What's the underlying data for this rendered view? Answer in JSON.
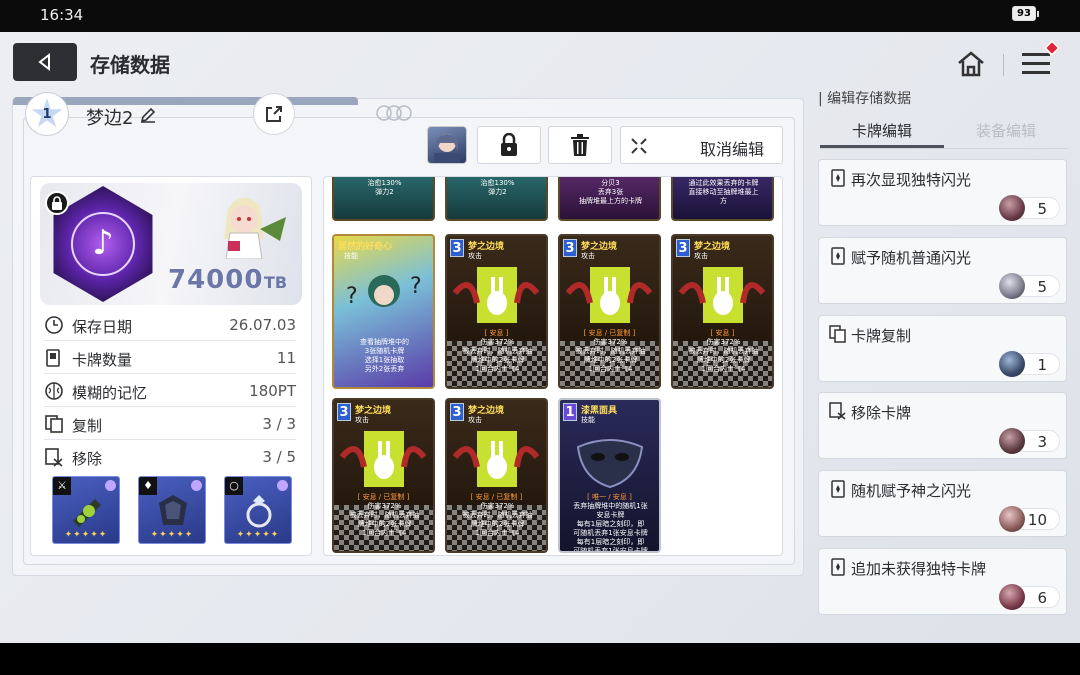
{
  "status": {
    "time": "16:34",
    "battery": "93"
  },
  "header": {
    "title": "存储数据"
  },
  "save": {
    "rank": "1",
    "name": "梦边2",
    "tb_value": "74000",
    "tb_unit": "TB",
    "stats": [
      {
        "label": "保存日期",
        "value": "26.07.03",
        "icon": "clock-icon"
      },
      {
        "label": "卡牌数量",
        "value": "11",
        "icon": "card-count-icon"
      },
      {
        "label": "模糊的记忆",
        "value": "180PT",
        "icon": "brain-icon"
      },
      {
        "label": "复制",
        "value": "3 / 3",
        "icon": "copy-icon"
      },
      {
        "label": "移除",
        "value": "3 / 5",
        "icon": "remove-icon"
      }
    ],
    "equipment": [
      {
        "slot": "weapon-icon",
        "stars": "✦✦✦✦✦"
      },
      {
        "slot": "armor-icon",
        "stars": "✦✦✦✦✦"
      },
      {
        "slot": "ring-icon",
        "stars": "✦✦✦✦✦"
      }
    ]
  },
  "toolbar": {
    "cancel_label": "取消编辑"
  },
  "deck": {
    "top_row": [
      {
        "desc": "治愈130%\n弹力2"
      },
      {
        "desc": "治愈130%\n弹力2"
      },
      {
        "desc": "分贝3\n丢弃3张\n抽牌堆最上方的卡牌"
      },
      {
        "desc": "通过此效果丢弃的卡牌\n直接移动至抽牌堆最上\n方"
      }
    ],
    "cards": [
      {
        "cost": "",
        "name": "居然的好奇心",
        "type": "技能",
        "tag": "",
        "desc": "查看抽牌堆中的\n3张随机卡牌\n选择1张抽取\n另外2张丢弃"
      },
      {
        "cost": "3",
        "name": "梦之边境",
        "type": "攻击",
        "tag": "[ 安息 ]",
        "desc": "伤害372%\n被丢弃时，随机丢弃抽\n牌堆中的2张卡牌\n1回合内士气4"
      },
      {
        "cost": "3",
        "name": "梦之边境",
        "type": "攻击",
        "tag": "[ 安息 / 已复制 ]",
        "desc": "伤害372%\n被丢弃时，随机丢弃抽\n牌堆中的2张卡牌\n1回合内士气4"
      },
      {
        "cost": "3",
        "name": "梦之边境",
        "type": "攻击",
        "tag": "[ 安息 ]",
        "desc": "伤害372%\n被丢弃时，随机丢弃抽\n牌堆中的2张卡牌\n1回合内士气4"
      },
      {
        "cost": "3",
        "name": "梦之边境",
        "type": "攻击",
        "tag": "[ 安息 / 已复制 ]",
        "desc": "伤害372%\n被丢弃时，随机丢弃抽\n牌堆中的2张卡牌\n1回合内士气4"
      },
      {
        "cost": "3",
        "name": "梦之边境",
        "type": "攻击",
        "tag": "[ 安息 / 已复制 ]",
        "desc": "伤害372%\n被丢弃时，随机丢弃抽\n牌堆中的2张卡牌\n1回合内士气4"
      },
      {
        "cost": "1",
        "name": "漆黑面具",
        "type": "技能",
        "tag": "[ 唯一 / 安息 ]",
        "desc": "丢弃抽牌堆中的随机1张\n安息卡牌\n每有1层暗之刻印，即\n可随机丢弃1张安息卡牌\n每有1层暗之刻印，即\n可随机丢弃1张安息卡牌"
      }
    ]
  },
  "right_panel": {
    "title": "编辑存储数据",
    "tabs": {
      "active": "卡牌编辑",
      "inactive": "装备编辑"
    },
    "options": [
      {
        "label": "再次显现独特闪光",
        "cost": "5"
      },
      {
        "label": "赋予随机普通闪光",
        "cost": "5"
      },
      {
        "label": "卡牌复制",
        "cost": "1"
      },
      {
        "label": "移除卡牌",
        "cost": "3"
      },
      {
        "label": "随机赋予神之闪光",
        "cost": "10"
      },
      {
        "label": "追加未获得独特卡牌",
        "cost": "6"
      }
    ]
  }
}
